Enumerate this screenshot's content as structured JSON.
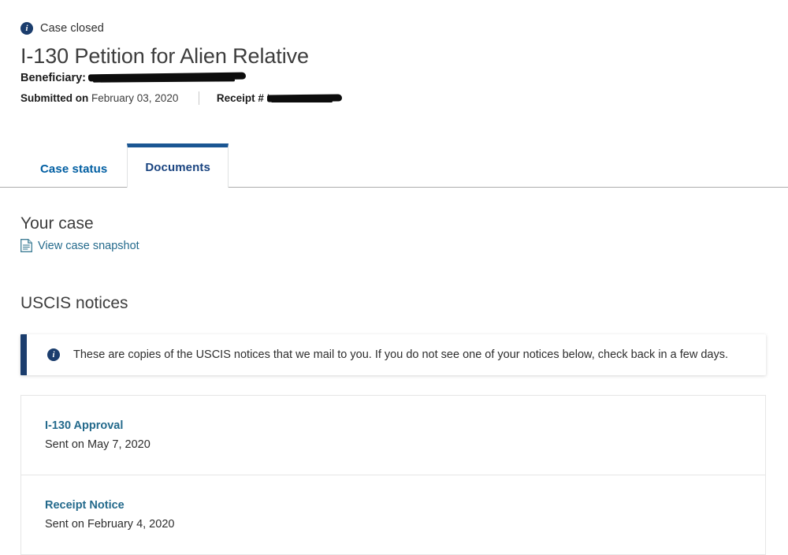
{
  "header": {
    "status_icon": "info-circle-icon",
    "status_text": "Case closed",
    "case_title": "I-130 Petition for Alien Relative",
    "beneficiary_label": "Beneficiary:",
    "beneficiary_name": "",
    "submitted_label": "Submitted on",
    "submitted_date": "February 03, 2020",
    "receipt_label": "Receipt #",
    "receipt_number": "I"
  },
  "tabs": [
    {
      "label": "Case status",
      "active": false,
      "name": "tab-case-status"
    },
    {
      "label": "Documents",
      "active": true,
      "name": "tab-documents"
    }
  ],
  "main": {
    "your_case_heading": "Your case",
    "snapshot_icon": "document-icon",
    "snapshot_link": "View case snapshot",
    "notices_heading": "USCIS notices",
    "callout": {
      "icon": "info-circle-icon",
      "text": "These are copies of the USCIS notices that we mail to you. If you do not see one of your notices below, check back in a few days."
    },
    "notices": [
      {
        "title": "I-130 Approval",
        "sent": "Sent on May 7, 2020"
      },
      {
        "title": "Receipt Notice",
        "sent": "Sent on February 4, 2020"
      }
    ]
  },
  "colors": {
    "accent_blue": "#1a4480",
    "link_teal": "#246a8c",
    "callout_bar": "#1b3d6d",
    "tab_active_top": "#1a5693",
    "redaction": "#0d0d0d"
  }
}
